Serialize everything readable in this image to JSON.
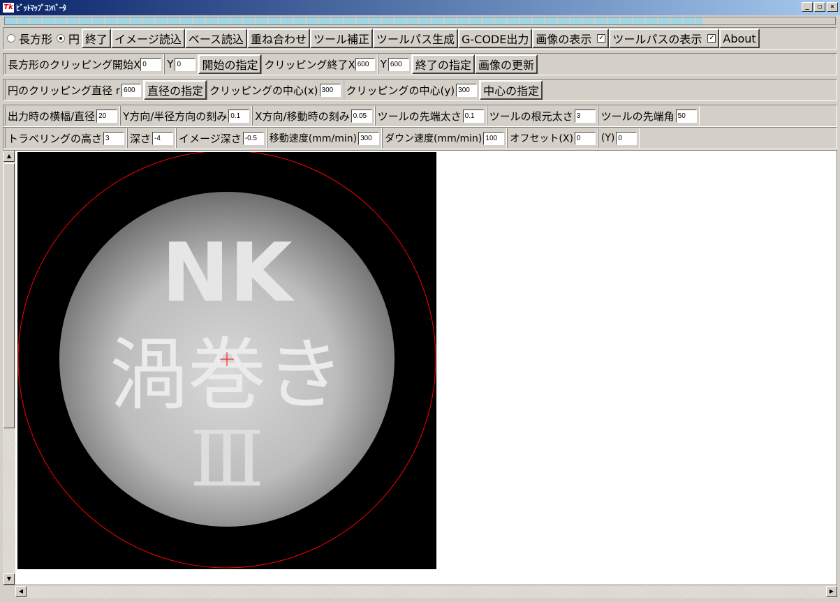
{
  "window": {
    "title": "ﾋﾞｯﾄﾏｯﾌﾟｺﾝﾊﾞｰﾀ",
    "icon": "app-icon",
    "controls": [
      "_",
      "□",
      "×"
    ]
  },
  "progress": {
    "value_percent": 84
  },
  "toolbar1": {
    "radio_rect": "長方形",
    "radio_circle": "円",
    "selected": "円",
    "exit": "終了",
    "load_image": "イメージ読込",
    "load_base": "ベース読込",
    "overlay": "重ね合わせ",
    "tool_correct": "ツール補正",
    "toolpath_gen": "ツールパス生成",
    "gcode_out": "G-CODE出力",
    "show_image": "画像の表示",
    "show_image_checked": true,
    "show_toolpath": "ツールパスの表示",
    "show_toolpath_checked": true,
    "about": "About"
  },
  "toolbar2": {
    "rect_start_label": "長方形のクリッピング開始X",
    "start_x": "0",
    "y_label": "Y",
    "start_y": "0",
    "set_start": "開始の指定",
    "end_x_label": "クリッピング終了X",
    "end_x": "600",
    "y2_label": "Y",
    "end_y": "600",
    "set_end": "終了の指定",
    "update_image": "画像の更新"
  },
  "toolbar3": {
    "diameter_label": "円のクリッピング直径 r",
    "diameter": "600",
    "set_diameter": "直径の指定",
    "center_x_label": "クリッピングの中心(x)",
    "center_x": "300",
    "center_y_label": "クリッピングの中心(y)",
    "center_y": "300",
    "set_center": "中心の指定"
  },
  "toolbar4": {
    "out_width_label": "出力時の横幅/直径",
    "out_width": "20",
    "y_step_label": "Y方向/半径方向の刻み",
    "y_step": "0.1",
    "x_step_label": "X方向/移動時の刻み",
    "x_step": "0.05",
    "tip_label": "ツールの先端太さ",
    "tip": "0.1",
    "root_label": "ツールの根元太さ",
    "root": "3",
    "angle_label": "ツールの先端角",
    "angle": "50"
  },
  "toolbar5": {
    "travel_label": "トラベリングの高さ",
    "travel": "3",
    "depth_label": "深さ",
    "depth": "-4",
    "img_depth_label": "イメージ深さ",
    "img_depth": "-0.5",
    "move_speed_label": "移動速度(mm/min)",
    "move_speed": "300",
    "down_speed_label": "ダウン速度(mm/min)",
    "down_speed": "100",
    "offset_x_label": "オフセット(X)",
    "offset_x": "0",
    "offset_y_label": "(Y)",
    "offset_y": "0"
  },
  "image": {
    "text_line1": "NK",
    "text_line2": "渦巻き",
    "text_line3": "Ⅲ",
    "clip_color": "#ff0000",
    "background": "#000000"
  }
}
